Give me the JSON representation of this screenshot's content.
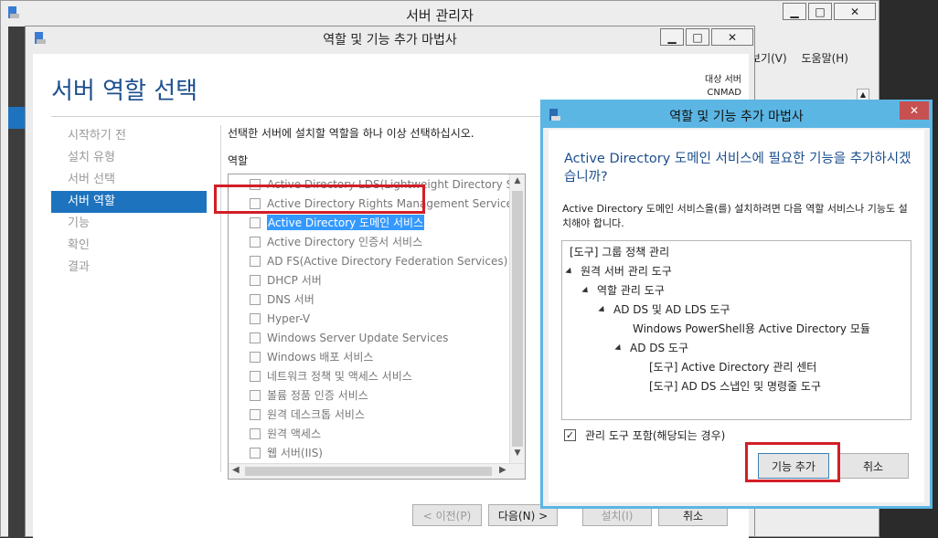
{
  "server_manager": {
    "title": "서버 관리자",
    "menu": [
      "보기(V)",
      "도움말(H)"
    ],
    "controls": {
      "minimize": "▁",
      "maximize": "□",
      "close": "✕"
    }
  },
  "wizard": {
    "title": "역할 및 기능 추가 마법사",
    "page_title": "서버 역할 선택",
    "target_label": "대상 서버",
    "target_server": "CNMAD",
    "nav": [
      {
        "label": "시작하기 전",
        "active": false
      },
      {
        "label": "설치 유형",
        "active": false
      },
      {
        "label": "서버 선택",
        "active": false
      },
      {
        "label": "서버 역할",
        "active": true
      },
      {
        "label": "기능",
        "active": false
      },
      {
        "label": "확인",
        "active": false
      },
      {
        "label": "결과",
        "active": false
      }
    ],
    "instruction": "선택한 서버에 설치할 역할을 하나 이상 선택하십시오.",
    "roles_label": "역할",
    "roles": [
      "Active Directory LDS(Lightweight Directory Servi",
      "Active Directory Rights Management Services",
      "Active Directory 도메인 서비스",
      "Active Directory 인증서 서비스",
      "AD FS(Active Directory Federation Services)",
      "DHCP 서버",
      "DNS 서버",
      "Hyper-V",
      "Windows Server Update Services",
      "Windows 배포 서비스",
      "네트워크 정책 및 액세스 서비스",
      "볼륨 정품 인증 서비스",
      "원격 데스크톱 서비스",
      "원격 액세스",
      "웹 서버(IIS)"
    ],
    "selected_role": "Active Directory 도메인 서비스",
    "buttons": {
      "prev": "< 이전(P)",
      "next": "다음(N) >",
      "install": "설치(I)",
      "cancel": "취소"
    }
  },
  "dialog": {
    "title": "역할 및 기능 추가 마법사",
    "question": "Active Directory 도메인 서비스에 필요한 기능을 추가하시겠습니까?",
    "description": "Active Directory 도메인 서비스을(를) 설치하려면 다음 역할 서비스나 기능도 설치해야 합니다.",
    "tree": [
      {
        "text": "[도구] 그룹 정책 관리",
        "expanded": false
      },
      {
        "text": "원격 서버 관리 도구",
        "expanded": true
      },
      {
        "text": "역할 관리 도구",
        "expanded": true
      },
      {
        "text": "AD DS 및 AD LDS 도구",
        "expanded": true
      },
      {
        "text": "Windows PowerShell용 Active Directory 모듈",
        "expanded": false
      },
      {
        "text": "AD DS 도구",
        "expanded": true
      },
      {
        "text": "[도구] Active Directory 관리 센터",
        "expanded": false
      },
      {
        "text": "[도구] AD DS 스냅인 및 명령줄 도구",
        "expanded": false
      }
    ],
    "include_mgmt_tools_label": "관리 도구 포함(해당되는 경우)",
    "include_mgmt_tools_checked": true,
    "add_button": "기능 추가",
    "cancel_button": "취소"
  }
}
